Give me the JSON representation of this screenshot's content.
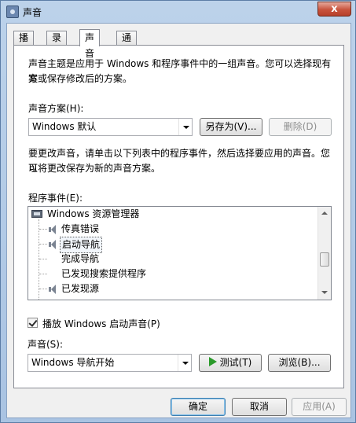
{
  "window": {
    "title": "声音",
    "close_label": "x"
  },
  "tabs": [
    {
      "label": "播放"
    },
    {
      "label": "录制"
    },
    {
      "label": "声音"
    },
    {
      "label": "通信"
    }
  ],
  "active_tab": "声音",
  "sounds": {
    "intro_line1": "声音主题是应用于 Windows 和程序事件中的一组声音。您可以选择现有方",
    "intro_line2": "案或保存修改后的方案。",
    "scheme_label": "声音方案(H):",
    "scheme_value": "Windows 默认",
    "save_as_label": "另存为(V)...",
    "delete_label": "删除(D)",
    "instructions_line1": "要更改声音，请单击以下列表中的程序事件，然后选择要应用的声音。您可",
    "instructions_line2": "以将更改保存为新的声音方案。",
    "events_label": "程序事件(E):",
    "events": {
      "group": "Windows 资源管理器",
      "items": [
        "传真错误",
        "启动导航",
        "完成导航",
        "已发现搜索提供程序",
        "已发现源"
      ],
      "selected": "启动导航"
    },
    "startup_checkbox_label": "播放 Windows 启动声音(P)",
    "startup_checked": true,
    "sound_label": "声音(S):",
    "sound_value": "Windows 导航开始",
    "test_label": "测试(T)",
    "browse_label": "浏览(B)..."
  },
  "footer": {
    "ok": "确定",
    "cancel": "取消",
    "apply": "应用(A)"
  }
}
